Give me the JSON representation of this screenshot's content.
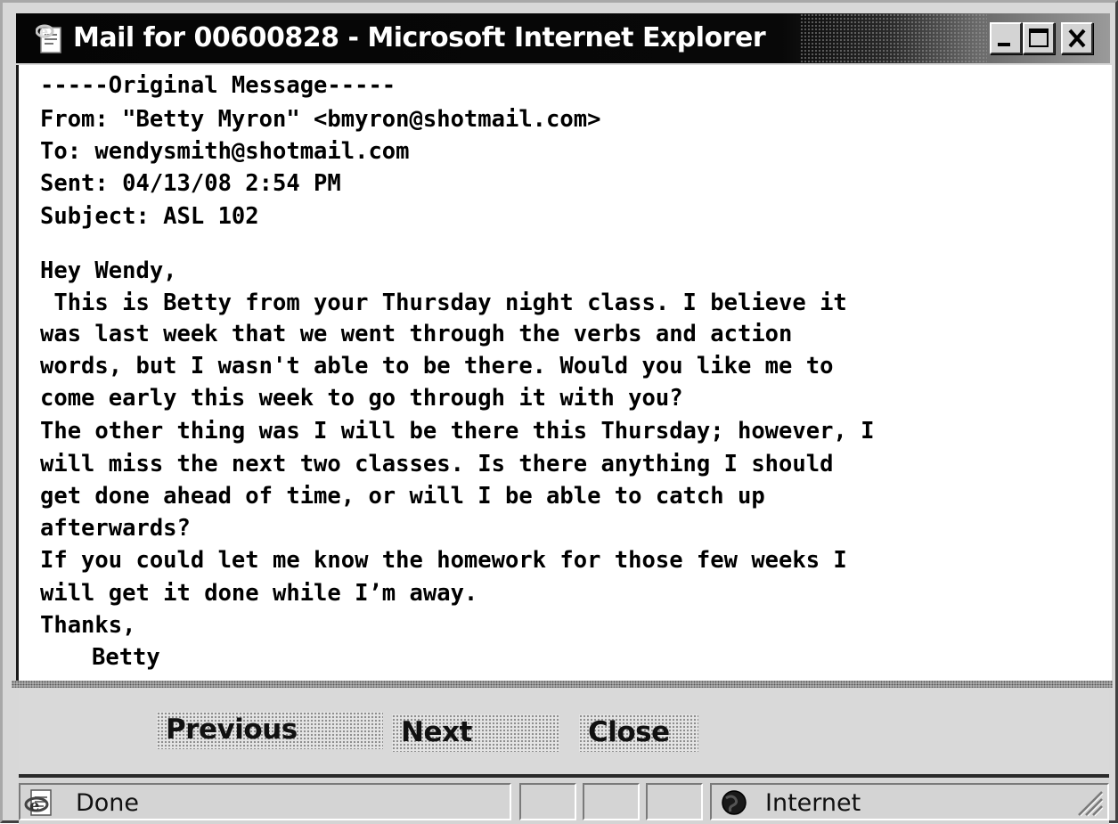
{
  "window": {
    "title": "Mail for 00600828 - Microsoft Internet Explorer",
    "icon": "ie-page-icon"
  },
  "controls": {
    "minimize_icon": "minimize-icon",
    "maximize_icon": "maximize-icon",
    "close_icon": "close-icon"
  },
  "message": {
    "header_rule": "-----Original Message-----",
    "from": "From: \"Betty Myron\" <bmyron@shotmail.com>",
    "to": "To: wendysmith@shotmail.com",
    "sent": "Sent: 04/13/08 2:54 PM",
    "subject": "Subject: ASL 102",
    "greeting": "Hey Wendy,",
    "body_lines": [
      " This is Betty from your Thursday night class. I believe it",
      "was last week that we went through the verbs and action",
      "words, but I wasn't able to be there. Would you like me to",
      "come early this week to go through it with you?",
      "The other thing was I will be there this Thursday; however, I",
      "will miss the next two classes. Is there anything I should",
      "get done ahead of time, or will I be able to catch up",
      "afterwards?",
      "If you could let me know the homework for those few weeks I",
      "will get it done while I’m away."
    ],
    "closing": "Thanks,",
    "signature": "Betty"
  },
  "buttons": {
    "previous": "Previous",
    "next": "Next",
    "close": "Close"
  },
  "statusbar": {
    "status": "Done",
    "zone": "Internet"
  }
}
